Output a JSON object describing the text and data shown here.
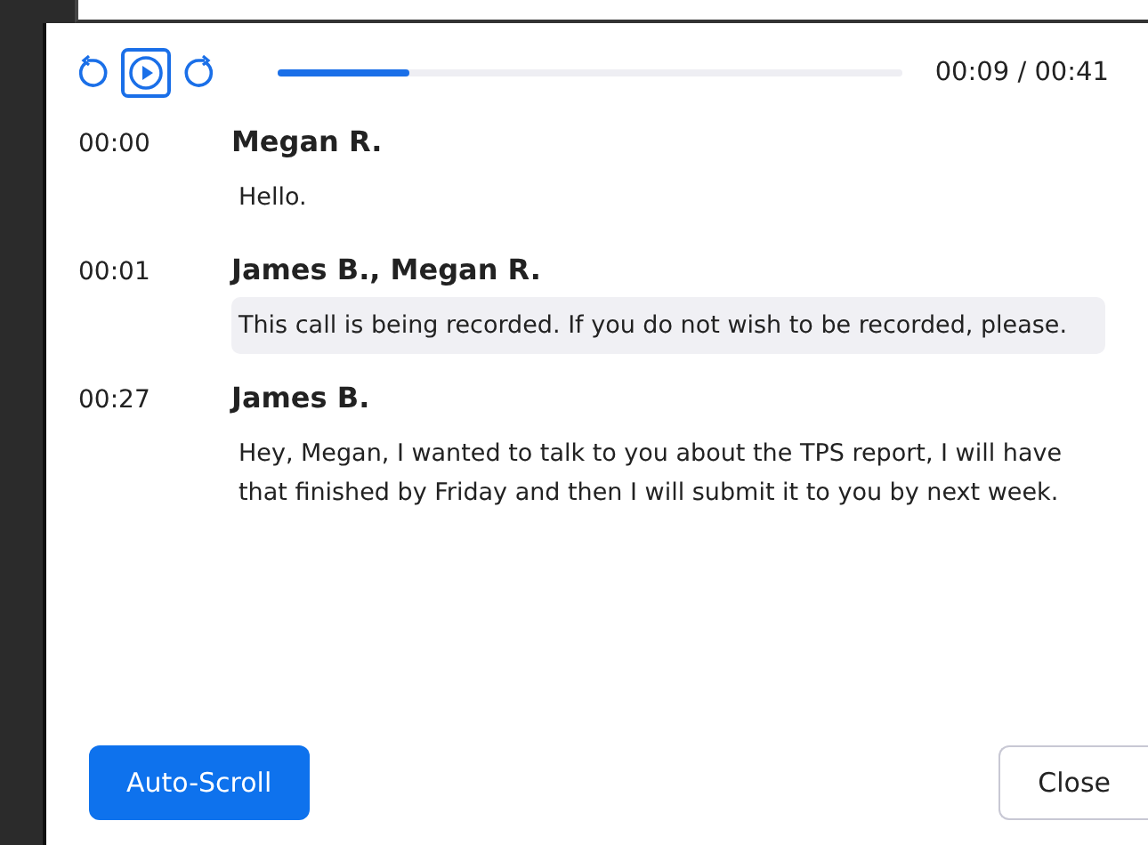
{
  "player": {
    "level": 0.21,
    "time": "00:09 / 00:41"
  },
  "entries": [
    {
      "time": "00:00",
      "speakers": "Megan R.",
      "text": "Hello.",
      "highlighted": false
    },
    {
      "time": "00:01",
      "speakers": "James B., Megan R.",
      "text": "This call is being recorded. If you do not wish to be recorded, please.",
      "highlighted": true
    },
    {
      "time": "00:27",
      "speakers": "James B.",
      "text": "Hey, Megan, I wanted to talk to you about the TPS report, I will have that finished by Friday and then I will submit it to you by next week.",
      "highlighted": false
    }
  ],
  "buttons": [
    {
      "label": "Auto-Scroll",
      "kind": "primary"
    },
    {
      "label": "Close",
      "kind": "secondary"
    }
  ]
}
